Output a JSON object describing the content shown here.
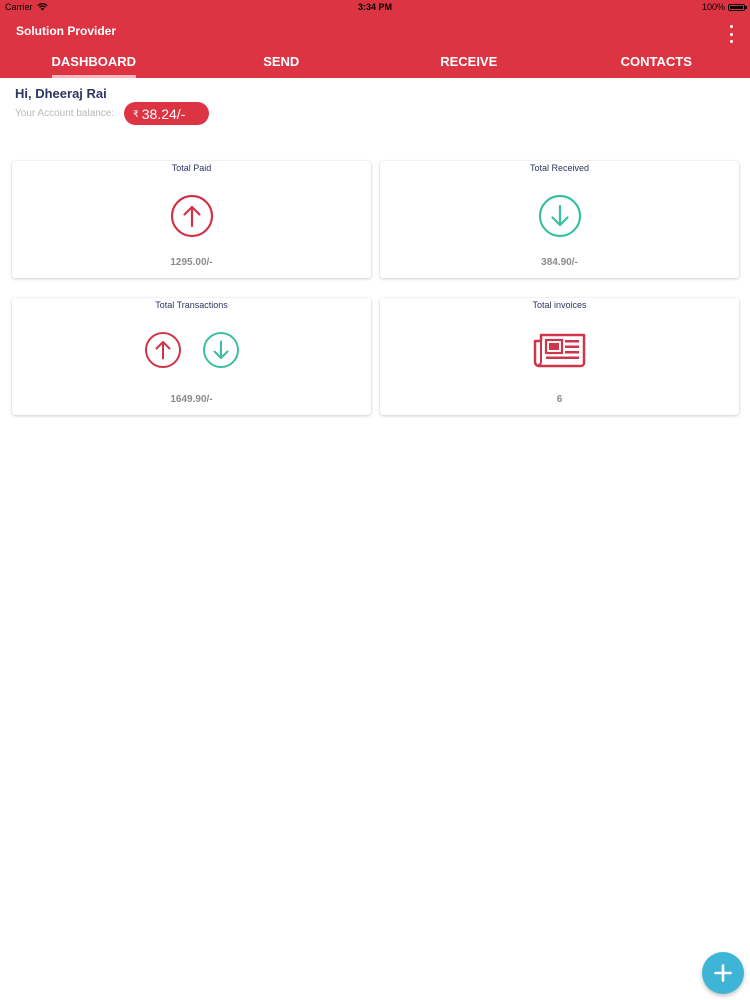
{
  "status_bar": {
    "carrier": "Carrier",
    "time": "3:34 PM",
    "battery": "100%",
    "battery_level": 1.0
  },
  "app_bar": {
    "title": "Solution Provider",
    "menu_icon": "overflow-menu-icon"
  },
  "tabs": [
    {
      "label": "DASHBOARD",
      "active": true
    },
    {
      "label": "SEND",
      "active": false
    },
    {
      "label": "RECEIVE",
      "active": false
    },
    {
      "label": "CONTACTS",
      "active": false
    }
  ],
  "account": {
    "greeting": "Hi, Dheeraj Rai",
    "balance_label": "Your Account balance:",
    "currency_symbol": "₹",
    "balance": "38.24/-"
  },
  "cards": {
    "paid": {
      "title": "Total Paid",
      "value": "1295.00/-",
      "icon": "arrow-up-circle-icon"
    },
    "received": {
      "title": "Total Received",
      "value": "384.90/-",
      "icon": "arrow-down-circle-icon"
    },
    "transactions": {
      "title": "Total Transactions",
      "value": "1649.90/-",
      "icons": [
        "arrow-up-circle-icon",
        "arrow-down-circle-icon"
      ]
    },
    "invoices": {
      "title": "Total  invoices",
      "value": "6",
      "icon": "newspaper-icon"
    }
  },
  "fab": {
    "icon": "plus-icon"
  },
  "colors": {
    "brand": "#dd3444",
    "paid": "#cf3448",
    "received": "#3bbfa0",
    "fab": "#3eb5d6",
    "title_text": "#2e3563"
  }
}
